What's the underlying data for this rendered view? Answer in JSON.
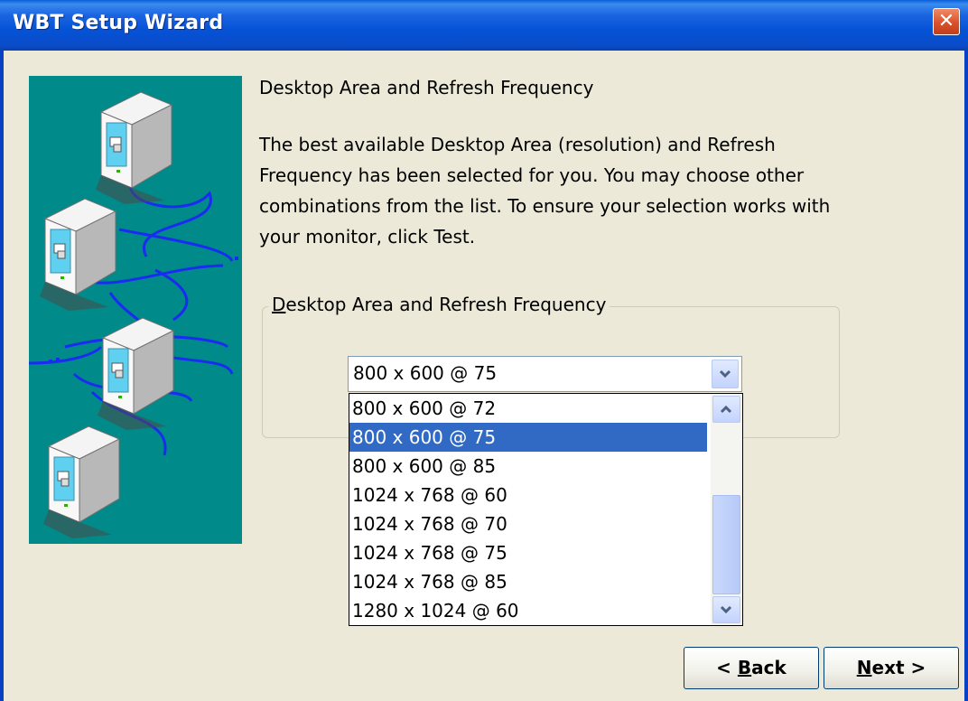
{
  "window": {
    "title": "WBT Setup Wizard",
    "close_label": "✕"
  },
  "content": {
    "heading": "Desktop Area and Refresh Frequency",
    "description": "The best available Desktop Area (resolution) and Refresh Frequency has been selected for you.  You may choose other combinations from the list.  To ensure your selection works with your monitor, click Test."
  },
  "group": {
    "legend_accel": "D",
    "legend_rest": "esktop Area and Refresh Frequency",
    "combo_value": "800 x 600 @ 75",
    "options": [
      "800 x 600 @ 72",
      "800 x 600 @ 75",
      "800 x 600 @ 85",
      "1024 x 768 @ 60",
      "1024 x 768 @ 70",
      "1024 x 768 @ 75",
      "1024 x 768 @ 85",
      "1280 x 1024 @ 60"
    ],
    "selected_option": "800 x 600 @ 75"
  },
  "buttons": {
    "back_prefix": "< ",
    "back_accel": "B",
    "back_rest": "ack",
    "next_accel": "N",
    "next_rest": "ext >"
  },
  "icons": {
    "close": "close-icon",
    "dropdown": "chevron-down-icon",
    "scroll_up": "chevron-up-icon",
    "scroll_down": "chevron-down-icon",
    "illustration": "networked-monitors-icon"
  },
  "colors": {
    "titlebar": "#0552d6",
    "selection": "#316ac5",
    "illustration_bg": "#008a8a",
    "close_button": "#d9512c",
    "dialog_bg": "#ece9d8"
  }
}
